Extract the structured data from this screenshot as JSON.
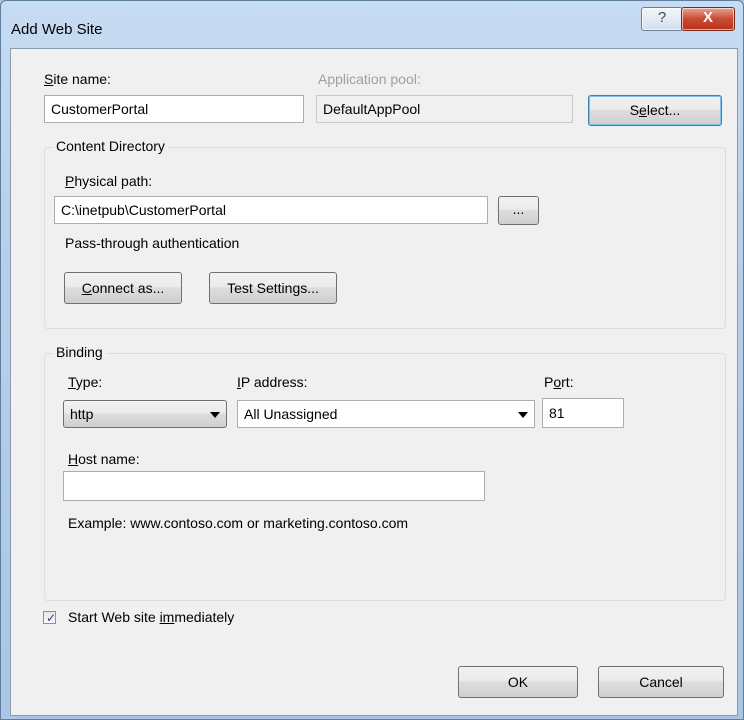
{
  "window": {
    "title": "Add Web Site",
    "help_glyph": "?",
    "close_glyph": "X"
  },
  "site": {
    "name_label_key": "S",
    "name_label_rest": "ite name:",
    "name_value": "CustomerPortal",
    "app_pool_label": "Application pool:",
    "app_pool_value": "DefaultAppPool",
    "select_button_pre": "S",
    "select_button_key": "e",
    "select_button_post": "lect..."
  },
  "content_directory": {
    "legend": "Content Directory",
    "physical_path_key": "P",
    "physical_path_rest": "hysical path:",
    "physical_path_value": "C:\\inetpub\\CustomerPortal",
    "browse_button": "...",
    "passthrough_label": "Pass-through authentication",
    "connect_as_key": "C",
    "connect_as_rest": "onnect as...",
    "test_settings_label": "Test Settings..."
  },
  "binding": {
    "legend": "Binding",
    "type_key": "T",
    "type_rest": "ype:",
    "type_value": "http",
    "ip_key": "I",
    "ip_rest": "P address:",
    "ip_value": "All Unassigned",
    "port_pre": "P",
    "port_key": "o",
    "port_post": "rt:",
    "port_value": "81",
    "host_key": "H",
    "host_rest": "ost name:",
    "host_value": "",
    "example_text": "Example: www.contoso.com or marketing.contoso.com"
  },
  "start_immediately": {
    "checked": true,
    "label_pre": "Start Web site ",
    "label_key": "im",
    "label_post": "mediately"
  },
  "footer": {
    "ok_label": "OK",
    "cancel_label": "Cancel"
  }
}
